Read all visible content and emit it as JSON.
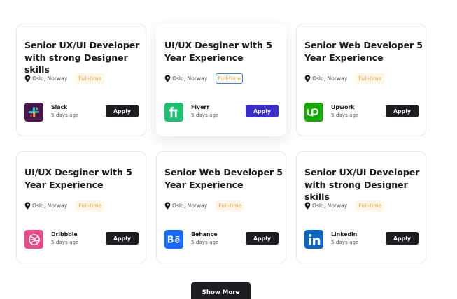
{
  "jobs": [
    {
      "title": "Senior UX/UI Developer with strong Designer skills",
      "location": "Oslo, Norway",
      "type": "Full-time",
      "company": "Slack",
      "posted": "5 days ago",
      "apply_label": "Apply",
      "logo_icon": "slack-logo-icon",
      "logo_bg": "#4a154b"
    },
    {
      "title": "UI/UX Desginer with 5 Year Experience",
      "location": "Oslo, Norway",
      "type": "Full-time",
      "company": "Fiverr",
      "posted": "5 days ago",
      "apply_label": "Apply",
      "logo_icon": "fiverr-logo-icon",
      "logo_bg": "#1dbf73"
    },
    {
      "title": "Senior Web Developer 5 Year Experience",
      "location": "Oslo, Norway",
      "type": "Full-time",
      "company": "Upwork",
      "posted": "5 days ago",
      "apply_label": "Apply",
      "logo_icon": "upwork-logo-icon",
      "logo_bg": "#14a800"
    },
    {
      "title": "UI/UX Desginer with 5 Year Experience",
      "location": "Oslo, Norway",
      "type": "Full-time",
      "company": "Dribbble",
      "posted": "5 days ago",
      "apply_label": "Apply",
      "logo_icon": "dribbble-logo-icon",
      "logo_bg": "#ea4c89"
    },
    {
      "title": "Senior Web Developer 5 Year Experience",
      "location": "Oslo, Norway",
      "type": "Full-time",
      "company": "Behance",
      "posted": "5 days ago",
      "apply_label": "Apply",
      "logo_icon": "behance-logo-icon",
      "logo_bg": "#1769ff"
    },
    {
      "title": "Senior UX/UI Developer with strong Designer skills",
      "location": "Oslo, Norway",
      "type": "Full-time",
      "company": "Linkedin",
      "posted": "5 days ago",
      "apply_label": "Apply",
      "logo_icon": "linkedin-logo-icon",
      "logo_bg": "#0a66c2"
    }
  ],
  "show_more_label": "Show More",
  "colors": {
    "accent": "#3a2fc9",
    "button_dark": "#1e1e22",
    "tag_text": "#f0a33a",
    "tag_bg": "#fff6ea",
    "selection_outline": "#3a82d8"
  }
}
